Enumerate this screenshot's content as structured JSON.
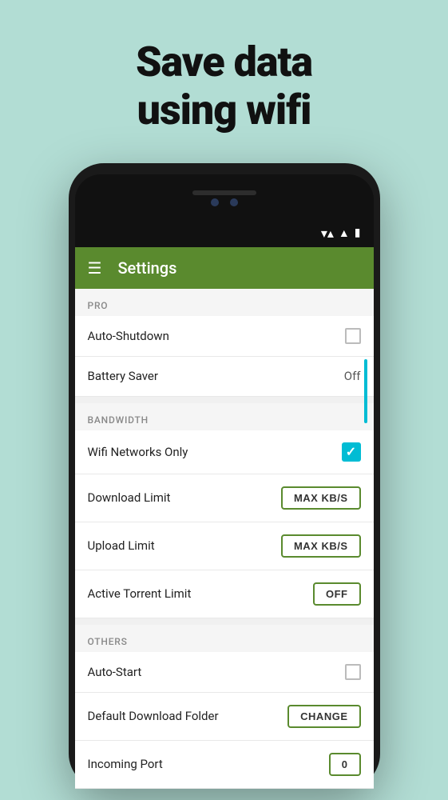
{
  "background_color": "#b2ddd4",
  "headline": {
    "line1": "Save data",
    "line2": "using wifi",
    "full": "Save data\nusing wifi"
  },
  "phone": {
    "status_bar": {
      "wifi": "▼▲",
      "signal": "▲",
      "battery": "▮"
    },
    "toolbar": {
      "title": "Settings",
      "hamburger": "☰"
    },
    "sections": [
      {
        "name": "PRO",
        "label": "PRO",
        "rows": [
          {
            "label": "Auto-Shutdown",
            "control_type": "checkbox",
            "checked": false,
            "value": ""
          },
          {
            "label": "Battery Saver",
            "control_type": "text",
            "checked": false,
            "value": "Off"
          }
        ]
      },
      {
        "name": "BANDWIDTH",
        "label": "BANDWIDTH",
        "rows": [
          {
            "label": "Wifi Networks Only",
            "control_type": "checkbox",
            "checked": true,
            "value": ""
          },
          {
            "label": "Download Limit",
            "control_type": "button",
            "checked": false,
            "value": "MAX KB/S"
          },
          {
            "label": "Upload Limit",
            "control_type": "button",
            "checked": false,
            "value": "MAX KB/S"
          },
          {
            "label": "Active Torrent Limit",
            "control_type": "button",
            "checked": false,
            "value": "OFF"
          }
        ]
      },
      {
        "name": "OTHERS",
        "label": "OTHERS",
        "rows": [
          {
            "label": "Auto-Start",
            "control_type": "checkbox",
            "checked": false,
            "value": ""
          },
          {
            "label": "Default Download Folder",
            "control_type": "button",
            "checked": false,
            "value": "CHANGE"
          },
          {
            "label": "Incoming Port",
            "control_type": "button",
            "checked": false,
            "value": "0"
          }
        ]
      }
    ]
  }
}
